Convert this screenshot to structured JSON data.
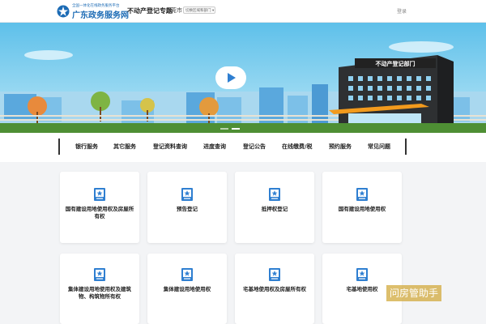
{
  "header": {
    "logo_small": "全国一体化在线政务服务平台",
    "logo_name": "广东政务服务网",
    "topic": "不动产登记专题",
    "city": "东莞市",
    "city_select": "切换区域和部门",
    "login": "登录"
  },
  "banner": {
    "building_sign": "不动产登记部门"
  },
  "nav": {
    "items": [
      "银行服务",
      "其它服务",
      "登记资料查询",
      "进度查询",
      "登记公告",
      "在线缴费/税",
      "预约服务",
      "常见问题"
    ]
  },
  "cards": [
    {
      "label": "国有建设用地使用权及房屋所有权"
    },
    {
      "label": "预告登记"
    },
    {
      "label": "抵押权登记"
    },
    {
      "label": "国有建设用地使用权"
    },
    {
      "label": "集体建设用地使用权及建筑物、构筑物所有权"
    },
    {
      "label": "集体建设用地使用权"
    },
    {
      "label": "宅基地使用权及房屋所有权"
    },
    {
      "label": "宅基地使用权"
    }
  ],
  "watermark": "问房管助手",
  "colors": {
    "brand": "#1c6bb5",
    "sky": "#6ec6ea",
    "grass": "#4e8f34",
    "icon": "#2f7fd1"
  }
}
